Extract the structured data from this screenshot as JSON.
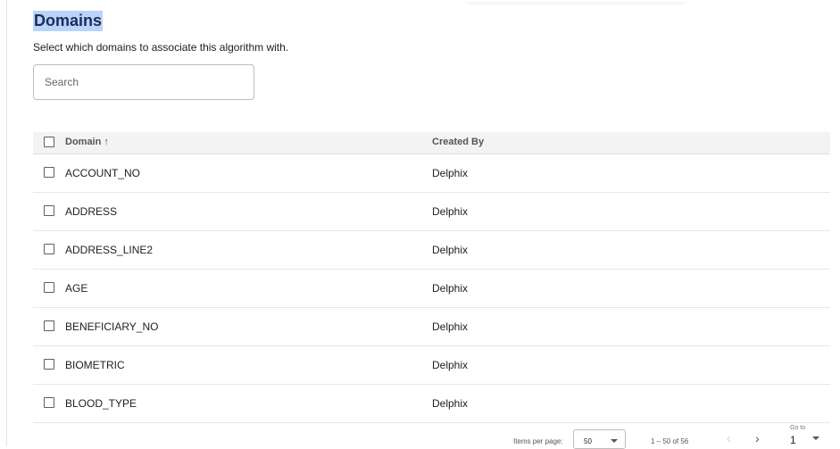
{
  "heading": "Domains",
  "subtitle": "Select which domains to associate this algorithm with.",
  "search": {
    "placeholder": "Search",
    "value": ""
  },
  "table": {
    "columns": {
      "domain": "Domain ↑",
      "created_by": "Created By"
    },
    "rows": [
      {
        "domain": "ACCOUNT_NO",
        "created_by": "Delphix"
      },
      {
        "domain": "ADDRESS",
        "created_by": "Delphix"
      },
      {
        "domain": "ADDRESS_LINE2",
        "created_by": "Delphix"
      },
      {
        "domain": "AGE",
        "created_by": "Delphix"
      },
      {
        "domain": "BENEFICIARY_NO",
        "created_by": "Delphix"
      },
      {
        "domain": "BIOMETRIC",
        "created_by": "Delphix"
      },
      {
        "domain": "BLOOD_TYPE",
        "created_by": "Delphix"
      }
    ]
  },
  "pagination": {
    "items_per_page_label": "Items per page:",
    "items_per_page_value": "50",
    "range_label": "1 – 50 of 56",
    "prev_icon": "‹",
    "next_icon": "›",
    "goto_label": "Go to",
    "goto_value": "1"
  },
  "colors": {
    "heading_highlight": "#b8d5f7",
    "heading_text": "#1f2a5a",
    "header_bg": "#f3f3f3"
  }
}
